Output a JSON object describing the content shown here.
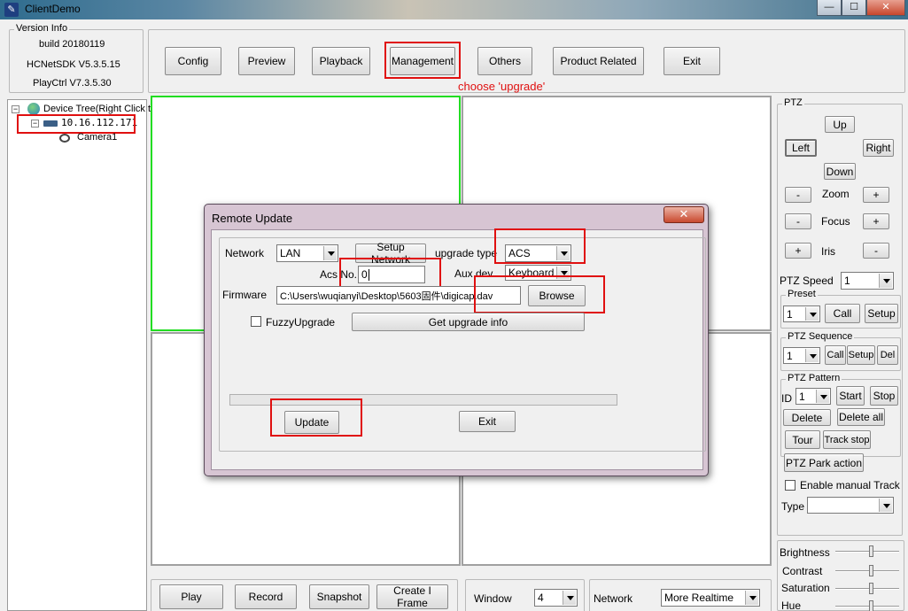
{
  "window": {
    "title": "ClientDemo",
    "controls": [
      "—",
      "☐",
      "✕"
    ]
  },
  "version": {
    "legend": "Version Info",
    "build": "build 20180119",
    "sdk": "HCNetSDK V5.3.5.15",
    "playctrl": "PlayCtrl V7.3.5.30"
  },
  "toolbar": {
    "config": "Config",
    "preview": "Preview",
    "playback": "Playback",
    "management": "Management",
    "others": "Others",
    "product": "Product Related",
    "exit": "Exit"
  },
  "annotation": "choose 'upgrade'",
  "tree": {
    "root": "Device Tree(Right Click t",
    "device": "10.16.112.171",
    "camera": "Camera1"
  },
  "ptz": {
    "legend": "PTZ",
    "up": "Up",
    "left": "Left",
    "right": "Right",
    "down": "Down",
    "minus": "-",
    "plus": "+",
    "zoom": "Zoom",
    "focus": "Focus",
    "iris": "Iris",
    "speed_label": "PTZ Speed",
    "speed_value": "1",
    "preset": {
      "legend": "Preset",
      "value": "1",
      "call": "Call",
      "setup": "Setup"
    },
    "sequence": {
      "legend": "PTZ Sequence",
      "value": "1",
      "call": "Call",
      "setup": "Setup",
      "del": "Del"
    },
    "pattern": {
      "legend": "PTZ Pattern",
      "id_label": "ID",
      "value": "1",
      "start": "Start",
      "stop": "Stop",
      "delete": "Delete",
      "delete_all": "Delete all"
    },
    "tour": "Tour",
    "track_stop": "Track stop",
    "park": "PTZ Park action",
    "manual_track": "Enable manual Track",
    "type_label": "Type"
  },
  "image": {
    "brightness": "Brightness",
    "contrast": "Contrast",
    "saturation": "Saturation",
    "hue": "Hue"
  },
  "bottom": {
    "play": "Play",
    "record": "Record",
    "snapshot": "Snapshot",
    "iframe": "Create I Frame",
    "window_label": "Window",
    "window_value": "4",
    "network_label": "Network",
    "network_value": "More Realtime"
  },
  "dialog": {
    "title": "Remote Update",
    "close": "✕",
    "network_label": "Network",
    "network_value": "LAN",
    "setup_network": "Setup Network",
    "upgrade_type_label": "upgrade type",
    "upgrade_type_value": "ACS",
    "acs_label": "Acs No.",
    "acs_value": "0",
    "aux_label": "Aux dev",
    "aux_value": "Keyboard",
    "firmware_label": "Firmware",
    "firmware_path": "C:\\Users\\wuqianyi\\Desktop\\5603固件\\digicap.dav",
    "browse": "Browse",
    "fuzzy": "FuzzyUpgrade",
    "get_info": "Get upgrade info",
    "update": "Update",
    "exit": "Exit"
  },
  "colors": {
    "highlight": "#e01010",
    "selected_pane": "#22dd22"
  }
}
